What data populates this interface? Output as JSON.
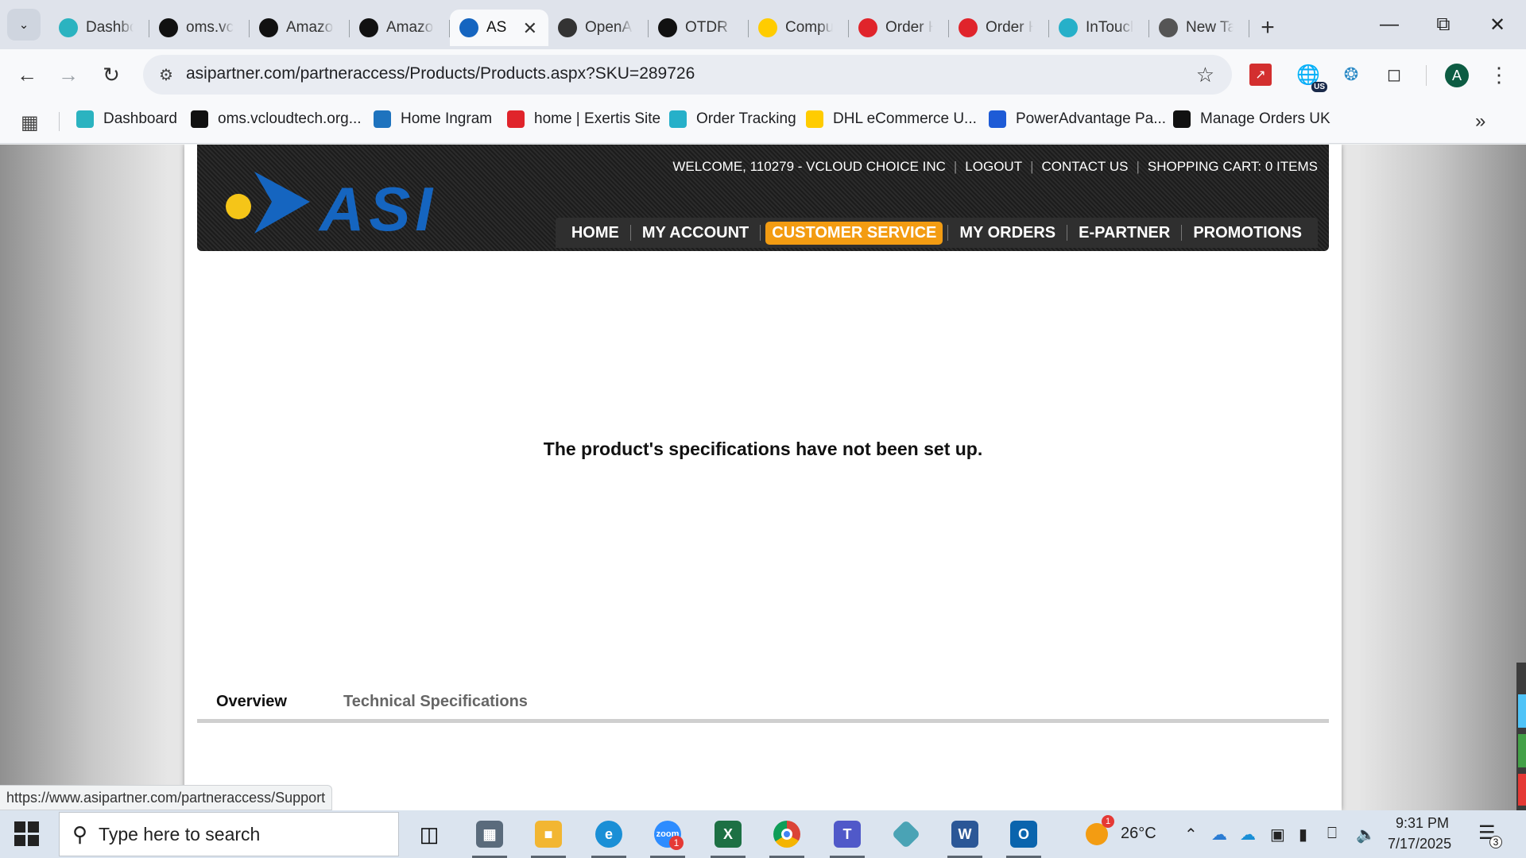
{
  "browser": {
    "tabs": [
      {
        "title": "Dashbo",
        "icon": "dashboard-favicon",
        "color": "#2bb3c0"
      },
      {
        "title": "oms.vc",
        "icon": "oms-favicon",
        "color": "#111111"
      },
      {
        "title": "Amazo",
        "icon": "amazon-favicon",
        "color": "#111111"
      },
      {
        "title": "Amazo",
        "icon": "amazon-favicon",
        "color": "#111111"
      },
      {
        "title": "AS",
        "icon": "asi-favicon",
        "color": "#1565c0",
        "active": true
      },
      {
        "title": "OpenA",
        "icon": "openai-favicon",
        "color": "#333333"
      },
      {
        "title": "OTDR C",
        "icon": "openai-favicon",
        "color": "#111111"
      },
      {
        "title": "Compu",
        "icon": "dhl-favicon",
        "color": "#ffcc00"
      },
      {
        "title": "Order H",
        "icon": "exertis-favicon",
        "color": "#e0242b"
      },
      {
        "title": "Order H",
        "icon": "exertis-favicon",
        "color": "#e0242b"
      },
      {
        "title": "InToucl",
        "icon": "intouch-favicon",
        "color": "#26b0c9"
      },
      {
        "title": "New Ta",
        "icon": "chrome-favicon",
        "color": "#555555"
      }
    ],
    "url": "asipartner.com/partneraccess/Products/Products.aspx?SKU=289726",
    "profile_initial": "A",
    "ext_badge": "US",
    "bookmarks": [
      {
        "label": "Dashboard",
        "color": "#2bb3c0"
      },
      {
        "label": "oms.vcloudtech.org...",
        "color": "#111111"
      },
      {
        "label": "Home Ingram",
        "color": "#1e73be"
      },
      {
        "label": "home | Exertis Site",
        "color": "#e0242b"
      },
      {
        "label": "Order Tracking",
        "color": "#26b0c9"
      },
      {
        "label": "DHL eCommerce U...",
        "color": "#ffcc00"
      },
      {
        "label": "PowerAdvantage Pa...",
        "color": "#1e5bd6"
      },
      {
        "label": "Manage Orders UK",
        "color": "#111111"
      }
    ],
    "status_url": "https://www.asipartner.com/partneraccess/Support"
  },
  "site": {
    "brand": "ASI",
    "welcome": "WELCOME, 110279 - VCLOUD CHOICE INC",
    "logout": "LOGOUT",
    "contact": "CONTACT US",
    "cart": "SHOPPING CART: 0 ITEMS",
    "nav": [
      "HOME",
      "MY ACCOUNT",
      "CUSTOMER SERVICE",
      "MY ORDERS",
      "E-PARTNER",
      "PROMOTIONS"
    ],
    "nav_active": "CUSTOMER SERVICE",
    "accent": "#f39c12",
    "notice": "The product's specifications have not been set up.",
    "product_tabs": [
      "Overview",
      "Technical Specifications"
    ]
  },
  "taskbar": {
    "search_placeholder": "Type here to search",
    "weather_temp": "26°C",
    "weather_badge": "1",
    "zoom_badge": "1",
    "time": "9:31 PM",
    "date": "7/17/2025",
    "notification_count": "3"
  }
}
